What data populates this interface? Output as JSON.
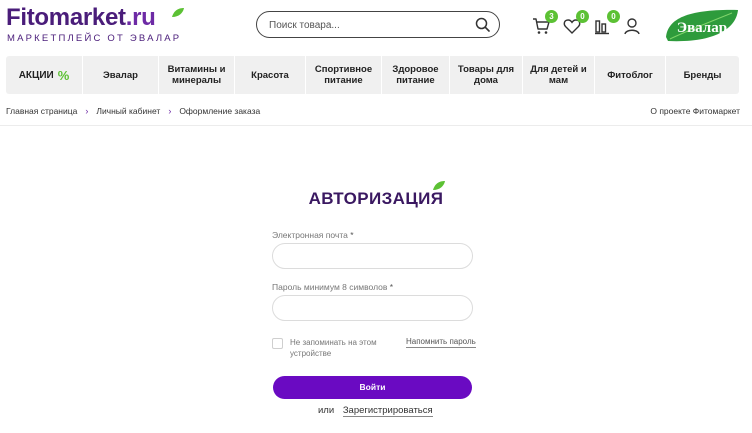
{
  "header": {
    "logo_main": "Fitomarket",
    "logo_domain": ".ru",
    "logo_sub": "МАРКЕТПЛЕЙС ОТ ЭВАЛАР",
    "search_placeholder": "Поиск товара...",
    "cart_count": "3",
    "favorites_count": "0",
    "compare_count": "0",
    "brand_badge": "Эвалар",
    "brand_color": "#2e9b3c",
    "accent_color": "#5cc134"
  },
  "nav": {
    "promo_label": "АКЦИИ",
    "promo_symbol": "%",
    "items": [
      "Эвалар",
      "Витамины и минералы",
      "Красота",
      "Спортивное питание",
      "Здоровое питание",
      "Товары для дома",
      "Для детей и мам",
      "Фитоблог",
      "Бренды"
    ]
  },
  "breadcrumbs": {
    "items": [
      "Главная страница",
      "Личный кабинет",
      "Оформление заказа"
    ],
    "about_link": "О проекте Фитомаркет"
  },
  "auth": {
    "title": "АВТОРИЗАЦИЯ",
    "email_label": "Электронная почта",
    "password_label": "Пароль минимум 8 символов",
    "required_mark": "*",
    "remember_label": "Не запоминать на этом устройстве",
    "forgot_link": "Напомнить пароль",
    "login_button": "Войти",
    "or_text": "или",
    "register_link": "Зарегистрироваться",
    "button_color": "#6a0ac2"
  }
}
